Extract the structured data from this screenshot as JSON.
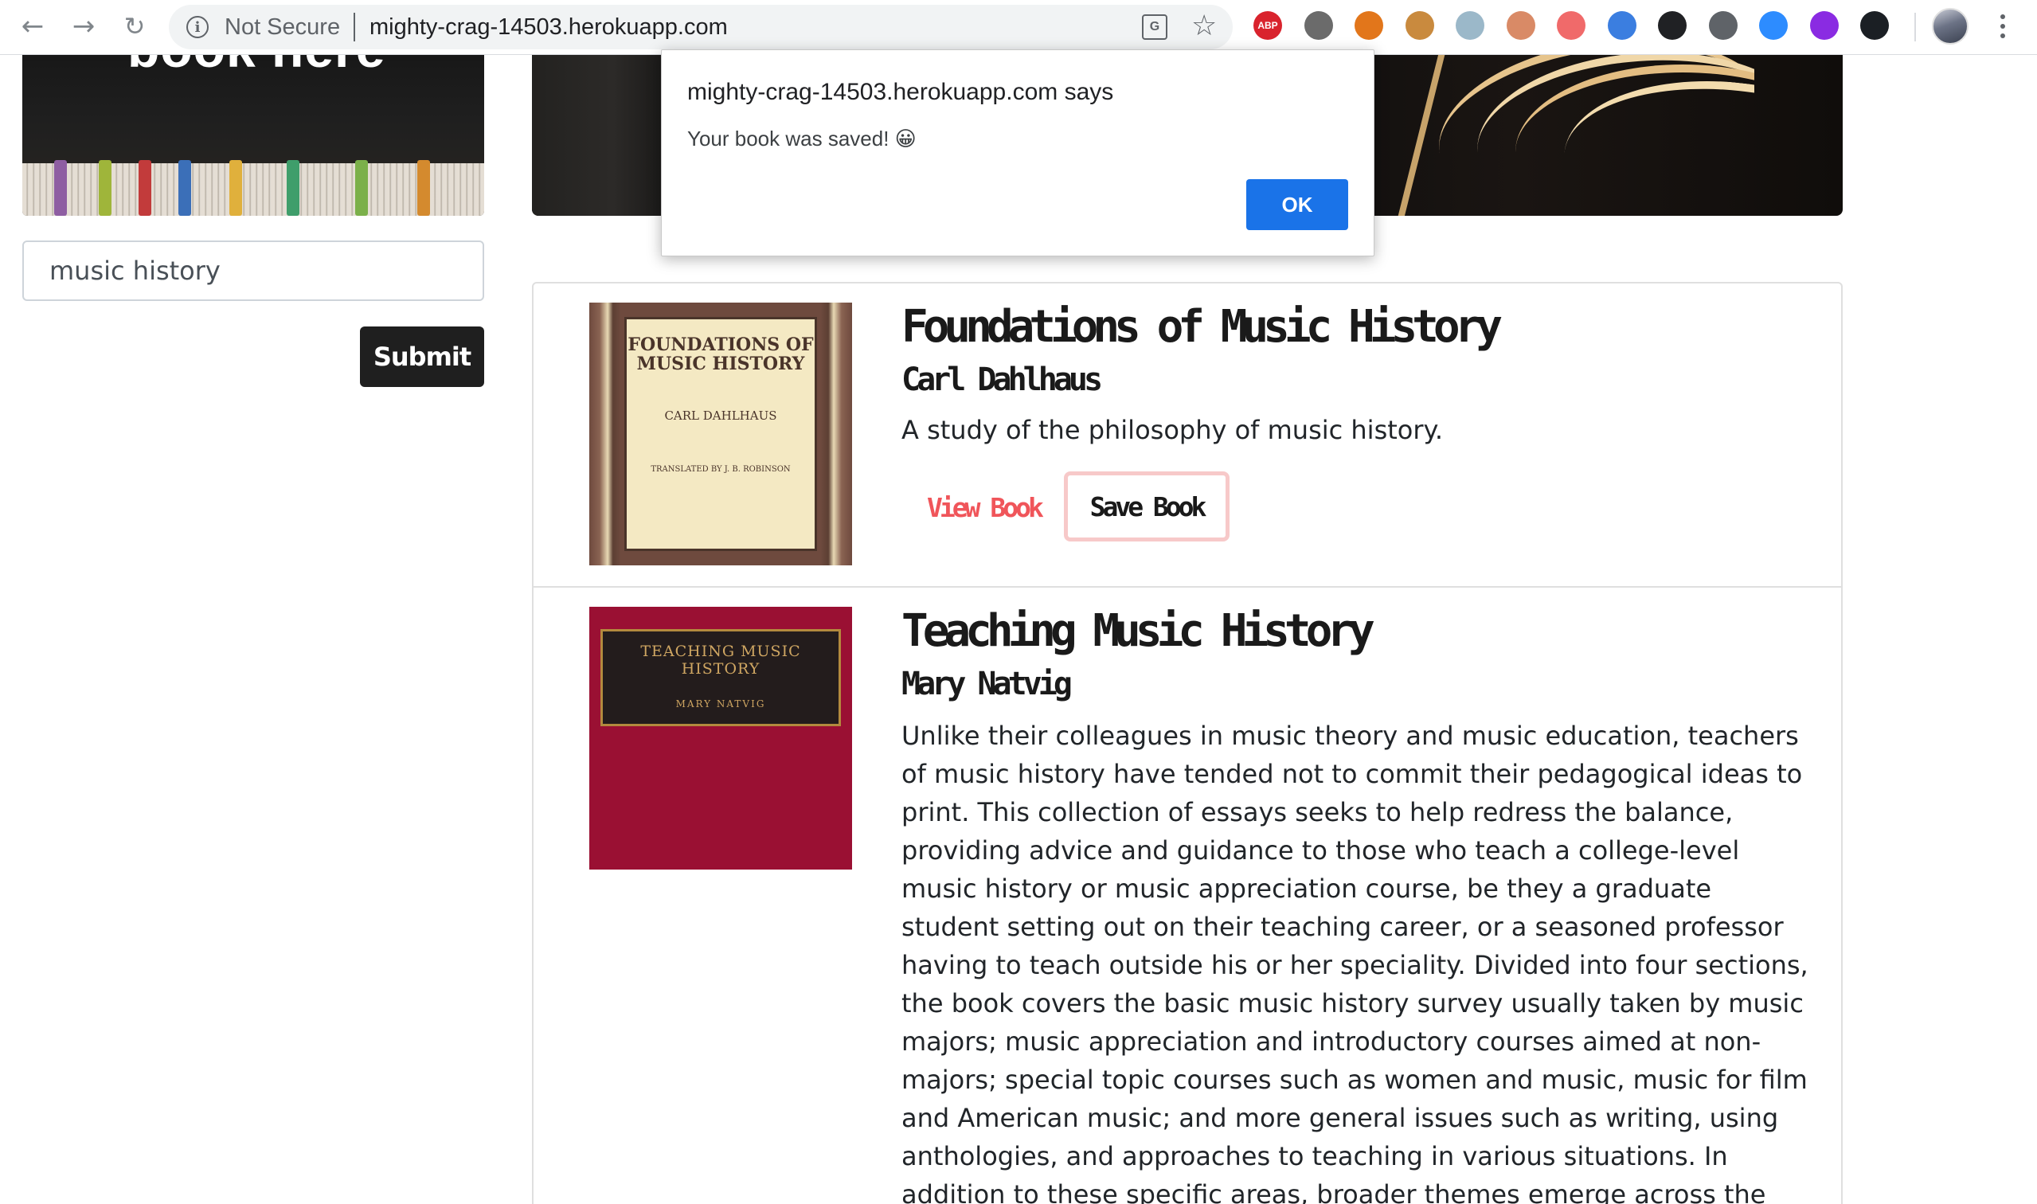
{
  "browser": {
    "security_label": "Not Secure",
    "url": "mighty-crag-14503.herokuapp.com",
    "info_glyph": "i",
    "translate_glyph": "G",
    "extensions": [
      {
        "icon": "adblock-icon",
        "label": "ABP",
        "color": "#d9232d"
      },
      {
        "icon": "extension-circle-icon",
        "label": "",
        "color": "#6b6b6b"
      },
      {
        "icon": "metamask-icon",
        "label": "",
        "color": "#e2761b"
      },
      {
        "icon": "cookie-icon",
        "label": "",
        "color": "#c98a3e"
      },
      {
        "icon": "bulb-icon",
        "label": "",
        "color": "#9bb8c9"
      },
      {
        "icon": "brain-icon",
        "label": "",
        "color": "#d98a66"
      },
      {
        "icon": "arrow-tag-icon",
        "label": "",
        "color": "#f06a6a"
      },
      {
        "icon": "eyedropper-icon",
        "label": "",
        "color": "#3b7ee0"
      },
      {
        "icon": "screenshot-icon",
        "label": "",
        "color": "#202124"
      },
      {
        "icon": "code-icon",
        "label": "",
        "color": "#5f6368"
      },
      {
        "icon": "zoom-icon",
        "label": "",
        "color": "#2d8cff"
      },
      {
        "icon": "mask-icon",
        "label": "",
        "color": "#8a2be2"
      },
      {
        "icon": "react-devtools-icon",
        "label": "",
        "color": "#1b1f24"
      }
    ]
  },
  "sidebar": {
    "banner_title": "book here",
    "search_value": "music history",
    "submit_label": "Submit"
  },
  "books": [
    {
      "title": "Foundations of Music History",
      "author": "Carl Dahlhaus",
      "description": "A study of the philosophy of music history.",
      "view_label": "View Book",
      "save_label": "Save Book",
      "cover": {
        "title": "FOUNDATIONS OF MUSIC HISTORY",
        "author": "CARL DAHLHAUS",
        "translator": "TRANSLATED BY J. B. ROBINSON"
      }
    },
    {
      "title": "Teaching Music History",
      "author": "Mary Natvig",
      "description": "Unlike their colleagues in music theory and music education, teachers of music history have tended not to commit their pedagogical ideas to print. This collection of essays seeks to help redress the balance, providing advice and guidance to those who teach a college-level music history or music appreciation course, be they a graduate student setting out on their teaching career, or a seasoned professor having to teach outside his or her speciality. Divided into four sections, the book covers the basic music history survey usually taken by music majors; music appreciation and introductory courses aimed at non-majors; special topic courses such as women and music, music for film and American music; and more general issues such as writing, using anthologies, and approaches to teaching in various situations. In addition to these specific areas, broader themes emerge across the essays. These include how to integrate social history and",
      "cover": {
        "title": "TEACHING MUSIC HISTORY",
        "author": "MARY NATVIG"
      }
    }
  ],
  "dialog": {
    "title": "mighty-crag-14503.herokuapp.com says",
    "message": "Your book was saved! 😀",
    "ok_label": "OK",
    "ok_color": "#1a73e8"
  }
}
